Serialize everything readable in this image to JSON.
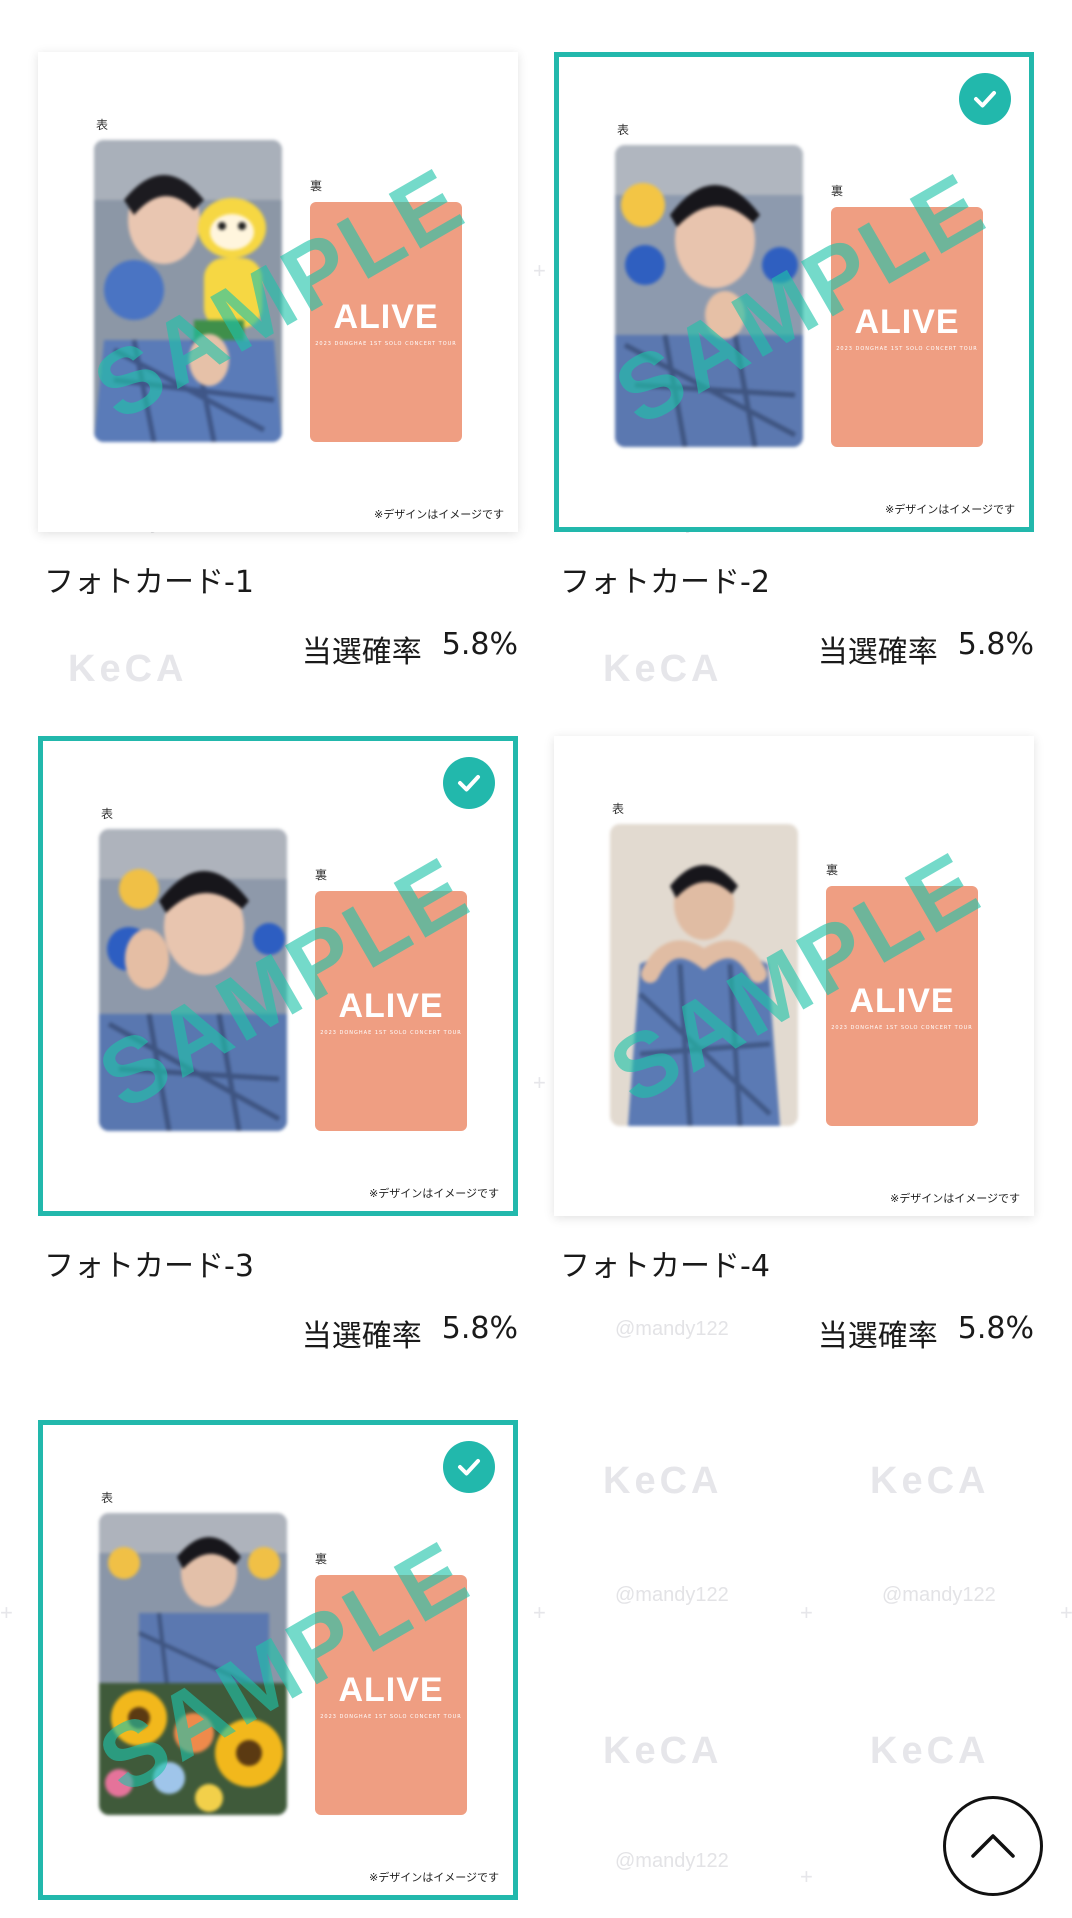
{
  "watermarks": {
    "logo": "KeCA",
    "handle": "@mandy122"
  },
  "common": {
    "front_label": "表",
    "back_label": "裏",
    "back_title": "ALIVE",
    "back_subtitle": "2023 DONGHAE 1ST SOLO CONCERT TOUR",
    "sample_overlay": "SAMPLE",
    "disclaimer": "※デザインはイメージです",
    "odds_label": "当選確率"
  },
  "cards": [
    {
      "name": "フォトカード-1",
      "odds": "5.8%",
      "selected": false,
      "photo": "photo-with-tiger-plush"
    },
    {
      "name": "フォトカード-2",
      "odds": "5.8%",
      "selected": true,
      "photo": "photo-finger-heart"
    },
    {
      "name": "フォトカード-3",
      "odds": "5.8%",
      "selected": true,
      "photo": "photo-hand-on-cheek"
    },
    {
      "name": "フォトカード-4",
      "odds": "5.8%",
      "selected": false,
      "photo": "photo-arm-heart"
    },
    {
      "name": "",
      "odds": "",
      "selected": true,
      "photo": "photo-with-sunflowers"
    }
  ],
  "colors": {
    "accent": "#22b8ac",
    "card_back": "#ef9e82",
    "sample_overlay": "#1fc4aa"
  },
  "scroll_top_icon": "chevron-up-icon"
}
